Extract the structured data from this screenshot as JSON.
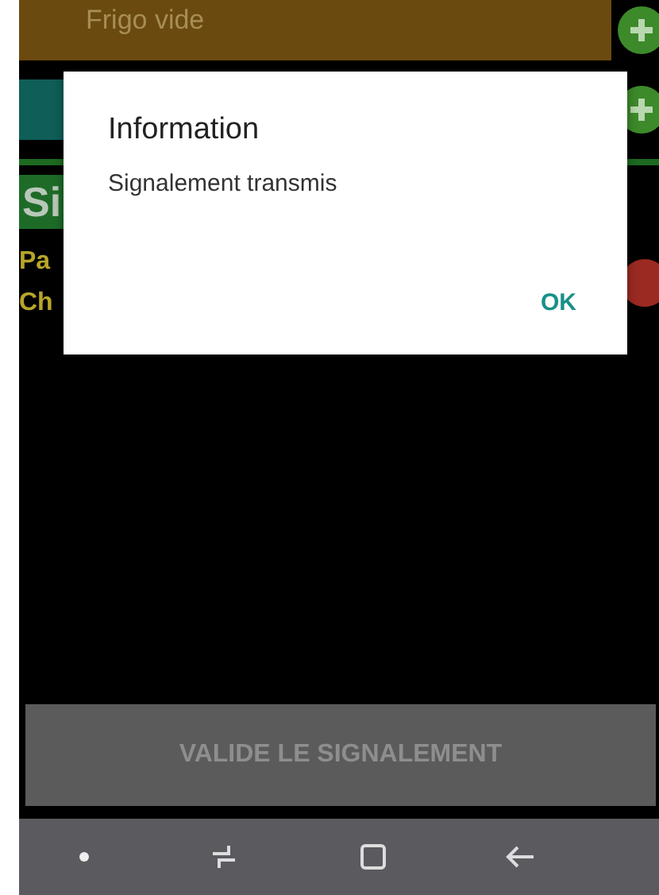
{
  "list_items": [
    {
      "label": "Frigo vide",
      "kind": "brown"
    },
    {
      "kind": "teal"
    }
  ],
  "section_title": "Si",
  "details": [
    "Pa",
    "Ch"
  ],
  "validate_button": {
    "label": "VALIDE LE SIGNALEMENT",
    "disabled": true
  },
  "dialog": {
    "title": "Information",
    "message": "Signalement transmis",
    "button": "OK"
  }
}
